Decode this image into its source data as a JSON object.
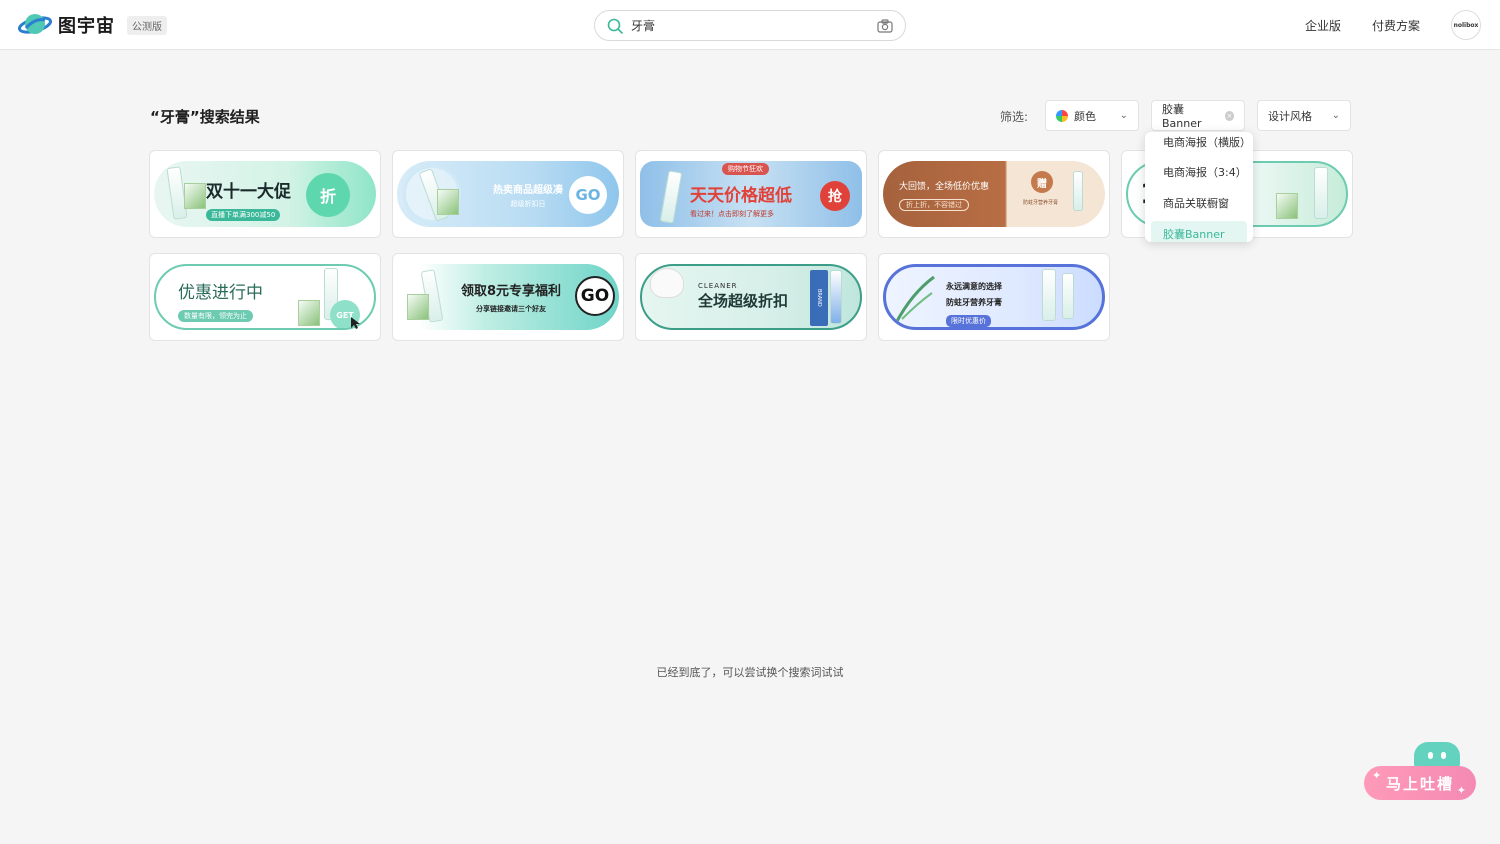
{
  "header": {
    "logo_text": "图宇宙",
    "beta_badge": "公测版",
    "search_value": "牙膏",
    "nav": [
      "企业版",
      "付费方案"
    ],
    "avatar_text": "nolibox"
  },
  "results": {
    "title": "“牙膏”搜索结果",
    "filter_label": "筛选:",
    "filter_color": "颜色",
    "filter_type": "胶囊Banner",
    "filter_style": "设计风格",
    "dropdown_items": [
      "电商海报（横版）",
      "电商海报（3:4）",
      "商品关联橱窗",
      "胶囊Banner"
    ],
    "dropdown_active_index": 3
  },
  "cards": [
    {
      "main": "双十一大促",
      "sub": "直播下单满300减50",
      "badge": "折"
    },
    {
      "main": "热卖商品超级凑",
      "sub": "超级折扣日",
      "badge": "GO"
    },
    {
      "main": "天天价格超低",
      "sub": "看过来！点击即刻了解更多",
      "top": "购物节狂欢",
      "badge": "抢"
    },
    {
      "main": "大回馈，全场低价优惠",
      "sub": "折上折，不容错过",
      "badge": "赠",
      "extra": "防蛀牙营养牙膏"
    },
    {
      "main": "1",
      "sub": "",
      "badge": ""
    },
    {
      "main": "优惠进行中",
      "sub": "数量有限，领完为止",
      "badge": "GET"
    },
    {
      "main": "领取8元专享福利",
      "sub": "分享链接邀请三个好友",
      "badge": "GO"
    },
    {
      "main": "全场超级折扣",
      "sub": "CLEANER",
      "badge": "BRAND"
    },
    {
      "main": "永远满意的选择",
      "sub": "防蛀牙营养牙膏",
      "badge": "限时优惠价"
    }
  ],
  "end_text": "已经到底了，可以尝试换个搜索词试试",
  "feedback": "马上吐槽",
  "colors": {
    "accent": "#3bb89a",
    "pink": "#f48ab3",
    "robot": "#63d3bf"
  }
}
